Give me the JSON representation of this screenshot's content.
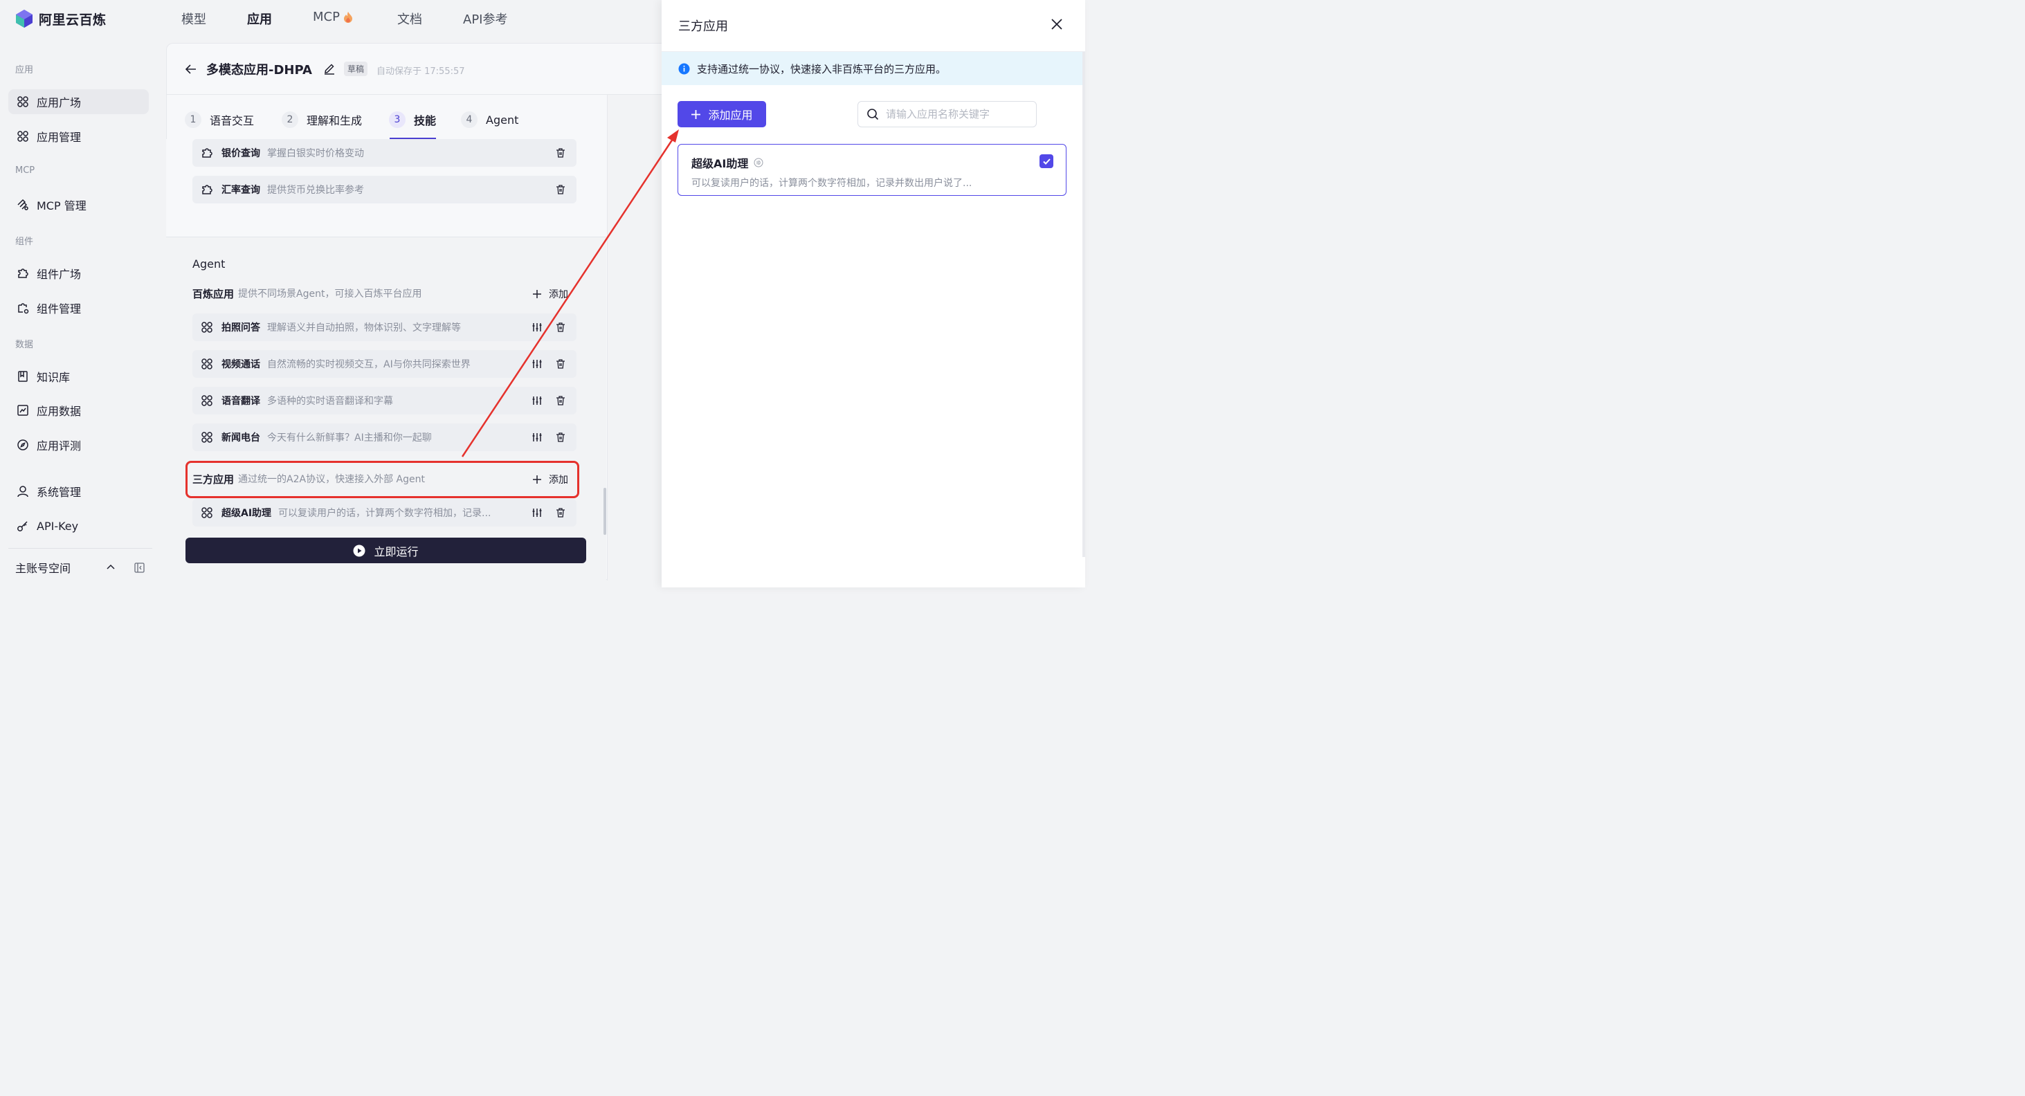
{
  "brand": {
    "name": "阿里云百炼"
  },
  "sidebar": {
    "groups": [
      {
        "label": "应用"
      },
      {
        "label": "MCP"
      },
      {
        "label": "组件"
      },
      {
        "label": "数据"
      }
    ],
    "items": [
      {
        "label": "应用广场",
        "icon": "app-grid-icon",
        "active": true
      },
      {
        "label": "应用管理",
        "icon": "app-grid-icon"
      },
      {
        "label": "MCP 管理",
        "icon": "mcp-icon"
      },
      {
        "label": "组件广场",
        "icon": "puzzle-icon"
      },
      {
        "label": "组件管理",
        "icon": "puzzle-gear-icon"
      },
      {
        "label": "知识库",
        "icon": "book-icon"
      },
      {
        "label": "应用数据",
        "icon": "chart-icon"
      },
      {
        "label": "应用评测",
        "icon": "compass-icon"
      },
      {
        "label": "系统管理",
        "icon": "user-icon"
      },
      {
        "label": "API-Key",
        "icon": "key-icon"
      }
    ],
    "workspace": "主账号空间"
  },
  "topnav": {
    "items": [
      {
        "label": "模型"
      },
      {
        "label": "应用",
        "active": true
      },
      {
        "label": "MCP"
      },
      {
        "label": "文档"
      },
      {
        "label": "API参考"
      }
    ]
  },
  "editor": {
    "title": "多模态应用-DHPA",
    "draft_badge": "草稿",
    "autosave": "自动保存于 17:55:57",
    "steps": [
      {
        "num": "1",
        "label": "语音交互"
      },
      {
        "num": "2",
        "label": "理解和生成"
      },
      {
        "num": "3",
        "label": "技能",
        "active": true
      },
      {
        "num": "4",
        "label": "Agent"
      }
    ],
    "skills": [
      {
        "name": "银价查询",
        "desc": "掌握白银实时价格变动"
      },
      {
        "name": "汇率查询",
        "desc": "提供货币兑换比率参考"
      }
    ],
    "agent_heading": "Agent",
    "bailian": {
      "title": "百炼应用",
      "desc": "提供不同场景Agent，可接入百炼平台应用",
      "add_label": "添加",
      "apps": [
        {
          "name": "拍照问答",
          "desc": "理解语义并自动拍照，物体识别、文字理解等"
        },
        {
          "name": "视频通话",
          "desc": "自然流畅的实时视频交互，AI与你共同探索世界"
        },
        {
          "name": "语音翻译",
          "desc": "多语种的实时语音翻译和字幕"
        },
        {
          "name": "新闻电台",
          "desc": "今天有什么新鲜事？AI主播和你一起聊"
        }
      ]
    },
    "third_party": {
      "title": "三方应用",
      "desc": "通过统一的A2A协议，快速接入外部 Agent",
      "add_label": "添加",
      "apps": [
        {
          "name": "超级AI助理",
          "desc": "可以复读用户的话，计算两个数字符相加，记录..."
        }
      ]
    },
    "run_label": "立即运行"
  },
  "drawer": {
    "title": "三方应用",
    "info": "支持通过统一协议，快速接入非百炼平台的三方应用。",
    "add_button": "添加应用",
    "search_placeholder": "请输入应用名称关键字",
    "search_value": "",
    "apps": [
      {
        "name": "超级AI助理",
        "desc": "可以复读用户的话，计算两个数字符相加，记录并数出用户说了...",
        "checked": true
      }
    ]
  },
  "colors": {
    "accent": "#5248e8",
    "annotation_red": "#e5322d",
    "run_button": "#22213a",
    "info_bg": "#e7f5fc"
  }
}
